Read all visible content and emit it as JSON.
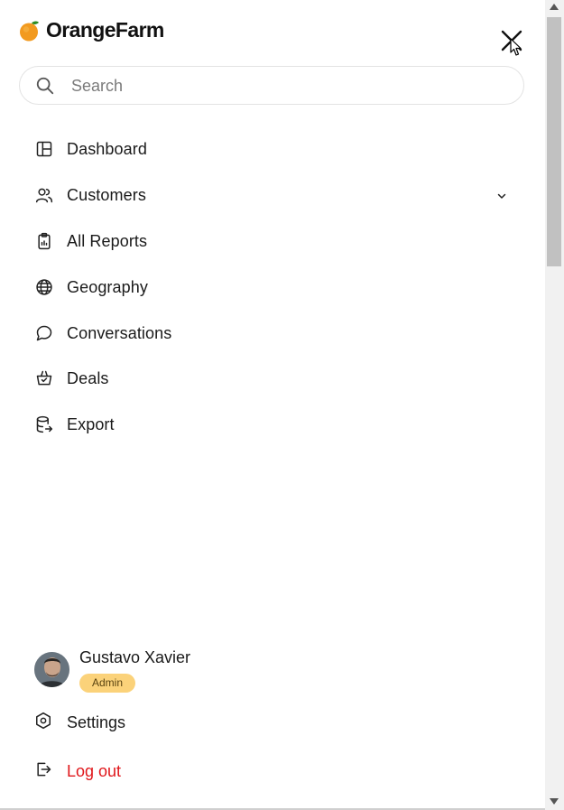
{
  "brand": {
    "name": "OrangeFarm",
    "icon": "orange-logo-icon",
    "color": "#f29a1f",
    "leaf_color": "#2e8b22"
  },
  "search": {
    "placeholder": "Search",
    "value": ""
  },
  "nav": {
    "items": [
      {
        "label": "Dashboard",
        "icon": "dashboard-icon"
      },
      {
        "label": "Customers",
        "icon": "users-icon",
        "has_submenu": true
      },
      {
        "label": "All Reports",
        "icon": "clipboard-icon"
      },
      {
        "label": "Geography",
        "icon": "globe-icon"
      },
      {
        "label": "Conversations",
        "icon": "chat-bubble-icon"
      },
      {
        "label": "Deals",
        "icon": "basket-icon"
      },
      {
        "label": "Export",
        "icon": "database-export-icon"
      }
    ]
  },
  "user": {
    "name": "Gustavo Xavier",
    "role": "Admin",
    "badge_color": "#fbd27a"
  },
  "footer": {
    "settings_label": "Settings",
    "logout_label": "Log out",
    "logout_color": "#e0161a"
  }
}
